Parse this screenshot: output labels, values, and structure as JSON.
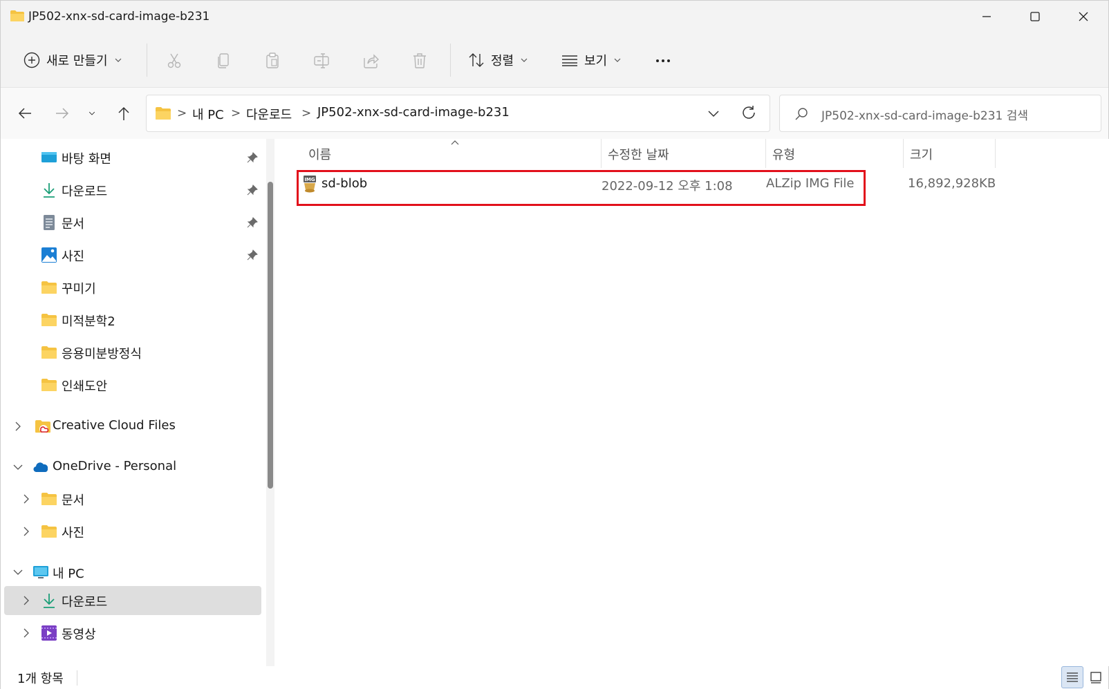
{
  "window": {
    "title": "JP502-xnx-sd-card-image-b231"
  },
  "toolbar": {
    "new_label": "새로 만들기",
    "sort_label": "정렬",
    "view_label": "보기",
    "more_label": "···"
  },
  "address": {
    "crumbs": [
      "내 PC",
      "다운로드",
      "JP502-xnx-sd-card-image-b231"
    ],
    "separator": ">"
  },
  "search": {
    "placeholder": "JP502-xnx-sd-card-image-b231 검색"
  },
  "sidebar": {
    "items": [
      {
        "label": "바탕 화면",
        "icon": "desktop-icon",
        "pinned": true
      },
      {
        "label": "다운로드",
        "icon": "download-icon",
        "pinned": true
      },
      {
        "label": "문서",
        "icon": "document-icon",
        "pinned": true
      },
      {
        "label": "사진",
        "icon": "pictures-icon",
        "pinned": true
      },
      {
        "label": "꾸미기",
        "icon": "folder-icon"
      },
      {
        "label": "미적분학2",
        "icon": "folder-icon"
      },
      {
        "label": "응용미분방정식",
        "icon": "folder-icon"
      },
      {
        "label": "인쇄도안",
        "icon": "folder-icon"
      },
      {
        "label": "Creative Cloud Files",
        "icon": "creative-cloud-folder-icon"
      },
      {
        "label": "OneDrive - Personal",
        "icon": "onedrive-icon"
      },
      {
        "label": "문서",
        "icon": "folder-icon"
      },
      {
        "label": "사진",
        "icon": "folder-icon"
      },
      {
        "label": "내 PC",
        "icon": "pc-icon"
      },
      {
        "label": "다운로드",
        "icon": "download-icon",
        "selected": true
      },
      {
        "label": "동영상",
        "icon": "videos-icon"
      }
    ]
  },
  "columns": {
    "name": "이름",
    "modified": "수정한 날짜",
    "type": "유형",
    "size": "크기"
  },
  "files": [
    {
      "name": "sd-blob",
      "modified": "2022-09-12 오후 1:08",
      "type": "ALZip IMG File",
      "size": "16,892,928KB",
      "icon": "img-file-icon",
      "highlighted": true
    }
  ],
  "status": {
    "count": "1개 항목"
  },
  "colors": {
    "highlight": "#e2101b",
    "folder": "#f5c342",
    "accent": "#0067c0"
  }
}
